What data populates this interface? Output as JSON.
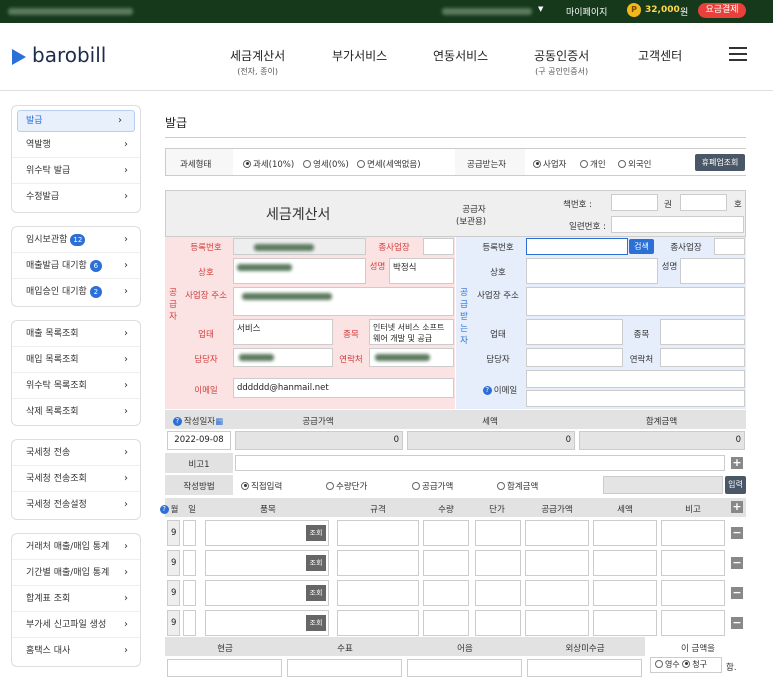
{
  "topbar": {
    "mypage": "마이페이지",
    "points": "32,000",
    "points_unit": "원",
    "charge": "요금결제"
  },
  "header": {
    "logo": "barobill",
    "nav": [
      {
        "label": "세금계산서",
        "sub": "(전자, 종이)"
      },
      {
        "label": "부가서비스",
        "sub": ""
      },
      {
        "label": "연동서비스",
        "sub": ""
      },
      {
        "label": "공동인증서",
        "sub": "(구 공인인증서)"
      },
      {
        "label": "고객센터",
        "sub": ""
      }
    ]
  },
  "sidebar": {
    "group1": [
      "발급",
      "역발행",
      "위수탁 발급",
      "수정발급"
    ],
    "group2": [
      {
        "label": "임시보관함",
        "badge": "12"
      },
      {
        "label": "매출발급 대기함",
        "badge": "6"
      },
      {
        "label": "매입승인 대기함",
        "badge": "2"
      }
    ],
    "group3": [
      "매출 목록조회",
      "매입 목록조회",
      "위수탁 목록조회",
      "삭제 목록조회"
    ],
    "group4": [
      "국세청 전송",
      "국세청 전송조회",
      "국세청 전송설정"
    ],
    "group5": [
      "거래처 매출/매입 통계",
      "기간별 매출/매입 통계",
      "합계표 조회",
      "부가세 신고파일 생성",
      "홈택스 대사"
    ]
  },
  "page": {
    "title": "발급"
  },
  "taxtype": {
    "label": "과세형태",
    "options": [
      "과세(10%)",
      "영세(0%)",
      "면세(세액없음)"
    ],
    "recv_label": "공급받는자",
    "recv_options": [
      "사업자",
      "개인",
      "외국인"
    ],
    "closed_btn": "휴폐업조회"
  },
  "invoice": {
    "title": "세금계산서",
    "supplier_copy": "공급자",
    "supplier_copy2": "(보관용)",
    "book_no": "책번호 :",
    "kwon": "권",
    "ho": "호",
    "serial_no": "일련번호 :"
  },
  "supplier": {
    "side_label": "공급자",
    "reg_no": "등록번호",
    "branch": "종사업장",
    "name": "상호",
    "rep": "성명",
    "rep_value": "박정식",
    "addr": "사업장 주소",
    "biz_type": "업태",
    "biz_type_value": "서비스",
    "biz_item": "종목",
    "biz_item_value": "인터넷 서비스 소프트웨어 개발 및 공급",
    "manager": "담당자",
    "contact": "연락처",
    "email": "이메일",
    "email_value": "dddddd@hanmail.net"
  },
  "buyer": {
    "side_label": "공급받는자",
    "reg_no": "등록번호",
    "search": "검색",
    "branch": "종사업장",
    "name": "상호",
    "rep": "성명",
    "addr": "사업장 주소",
    "biz_type": "업태",
    "biz_item": "종목",
    "manager": "담당자",
    "contact": "연락처",
    "email": "이메일"
  },
  "summary": {
    "date_label": "작성일자",
    "date_value": "2022-09-08",
    "supply_label": "공급가액",
    "supply_value": "0",
    "tax_label": "세액",
    "tax_value": "0",
    "total_label": "합계금액",
    "total_value": "0",
    "memo_label": "비고1",
    "method_label": "작성방법",
    "methods": [
      "직접입력",
      "수량단가",
      "공급가액",
      "합계금액"
    ],
    "input_btn": "입력"
  },
  "items": {
    "headers": [
      "월",
      "일",
      "품목",
      "규격",
      "수량",
      "단가",
      "공급가액",
      "세액",
      "비고"
    ],
    "lookup": "조회",
    "rows": [
      {
        "month": "9"
      },
      {
        "month": "9"
      },
      {
        "month": "9"
      },
      {
        "month": "9"
      }
    ]
  },
  "payment": {
    "headers": [
      "현금",
      "수표",
      "어음",
      "외상미수금"
    ],
    "amount_label": "이 금액을",
    "receipt": "영수",
    "claim": "청구",
    "suffix": "함."
  }
}
